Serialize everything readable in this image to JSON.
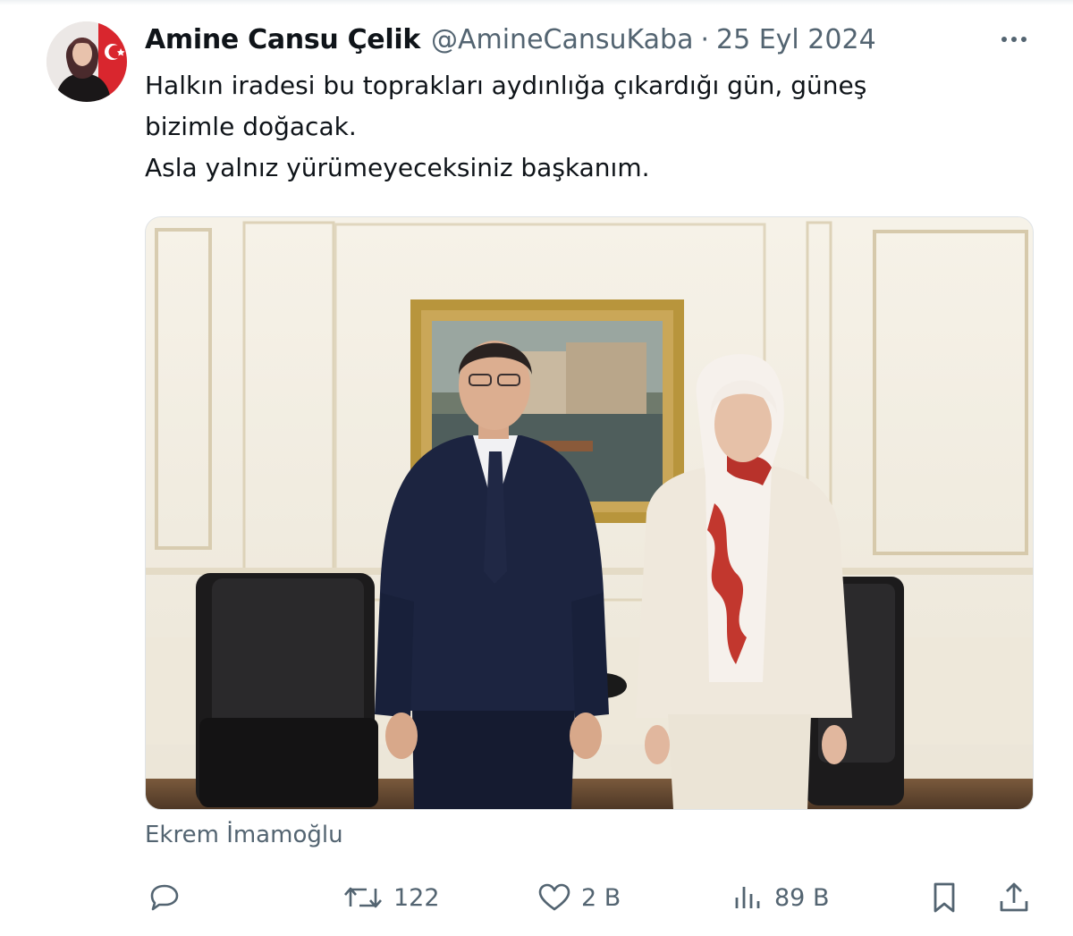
{
  "tweet": {
    "author_name": "Amine Cansu Çelik",
    "handle": "@AmineCansuKaba",
    "separator": "·",
    "date": "25 Eyl 2024",
    "text_lines": [
      "Halkın iradesi bu toprakları aydınlığa çıkardığı gün, güneş",
      "bizimle doğacak.",
      "Asla yalnız yürümeyeceksiniz başkanım."
    ],
    "tagged_person": "Ekrem İmamoğlu"
  },
  "actions": {
    "reply_count": "",
    "retweet_count": "122",
    "like_count": "2 B",
    "views_count": "89 B"
  },
  "icons": {
    "more": "more-horizontal-icon",
    "reply": "reply-icon",
    "retweet": "retweet-icon",
    "like": "heart-icon",
    "views": "views-bar-icon",
    "bookmark": "bookmark-icon",
    "share": "share-icon"
  },
  "colors": {
    "text_primary": "#0f1419",
    "text_secondary": "#536471",
    "border": "#dfe3e6"
  }
}
